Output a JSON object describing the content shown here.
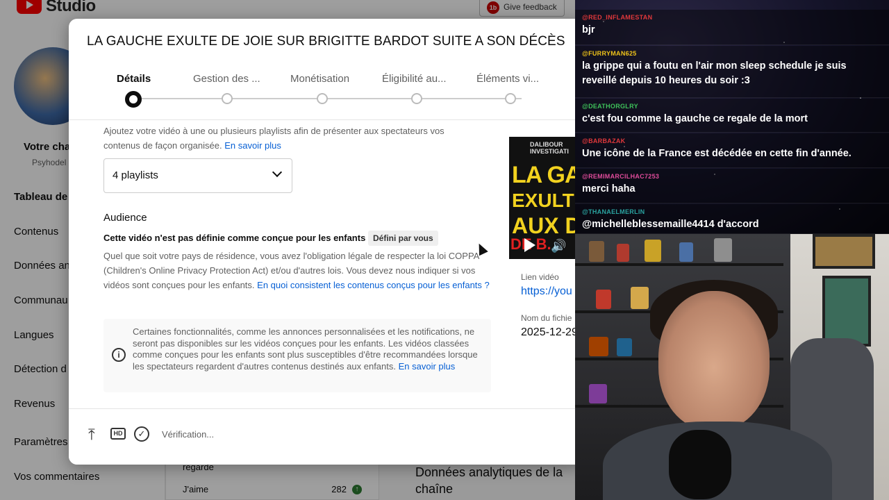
{
  "studio": {
    "logo_text": "Studio",
    "feedback_label": "Give feedback",
    "feedback_icon_text": "1b",
    "channel": {
      "name": "Votre cha",
      "handle": "Psyhodel"
    },
    "nav": [
      "Tableau de",
      "Contenus",
      "Données an",
      "Communau",
      "Langues",
      "Détection d",
      "Revenus",
      "Paramètres",
      "Vos commentaires"
    ],
    "dashboard": {
      "row_regarde": "regarde",
      "row_jaime": "J'aime",
      "jaime_value": "282",
      "analytics_title": "Données analytiques de la chaîne"
    }
  },
  "dialog": {
    "title": "LA GAUCHE EXULTE DE JOIE SUR BRIGITTE BARDOT SUITE A SON DÉCÈS",
    "steps": [
      "Détails",
      "Gestion des ...",
      "Monétisation",
      "Éligibilité au...",
      "Éléments vi..."
    ],
    "active_step": 0,
    "playlists": {
      "description": "Ajoutez votre vidéo à une ou plusieurs playlists afin de présenter aux spectateurs vos contenus de façon organisée.",
      "link": "En savoir plus",
      "selected": "4 playlists"
    },
    "audience": {
      "title": "Audience",
      "status": "Cette vidéo n'est pas définie comme conçue pour les enfants",
      "chip": "Défini par vous",
      "coppa_text": "Quel que soit votre pays de résidence, vous avez l'obligation légale de respecter la loi COPPA (Children's Online Privacy Protection Act) et/ou d'autres lois. Vous devez nous indiquer si vos vidéos sont conçues pour les enfants.",
      "coppa_link": "En quoi consistent les contenus conçus pour les enfants ?",
      "info_text": "Certaines fonctionnalités, comme les annonces personnalisées et les notifications, ne seront pas disponibles sur les vidéos conçues pour les enfants. Les vidéos classées comme conçues pour les enfants sont plus susceptibles d'être recommandées lorsque les spectateurs regardent d'autres contenus destinés aux enfants.",
      "info_link": "En savoir plus",
      "info_icon": "info-icon"
    },
    "preview": {
      "thumb_channel": "DALIBOUR INVESTIGATI",
      "thumb_lines": [
        "LA GAU",
        "EXULTE D",
        "AUX D",
        "DE B."
      ],
      "link_label": "Lien vidéo",
      "link_value": "https://you",
      "file_label": "Nom du fichie",
      "file_value": "2025-12-29"
    },
    "footer": {
      "hd_label": "HD",
      "status": "Vérification..."
    }
  },
  "chat": {
    "messages": [
      {
        "user": "@RED_INFLAMESTAN",
        "text": "bjr",
        "color": "#e0383b"
      },
      {
        "user": "@FURRYMAN625",
        "text": "la grippe qui a foutu en l'air mon sleep schedule je suis reveillé depuis 10 heures du soir :3",
        "color": "#f0c419"
      },
      {
        "user": "@DEATHORGLRY",
        "text": "c'est fou comme la gauche ce regale de la mort",
        "color": "#3ec25a"
      },
      {
        "user": "@BARBAZAK",
        "text": "Une icône de la France est décédée en cette fin d'année.",
        "color": "#e0383b"
      },
      {
        "user": "@REMIMARCILHAC7253",
        "text": "merci haha",
        "color": "#e04c9b"
      },
      {
        "user": "@THANAELMERLIN",
        "text": "@michelleblessemaille4414 d'accord",
        "color": "#2aa3a0"
      }
    ]
  }
}
